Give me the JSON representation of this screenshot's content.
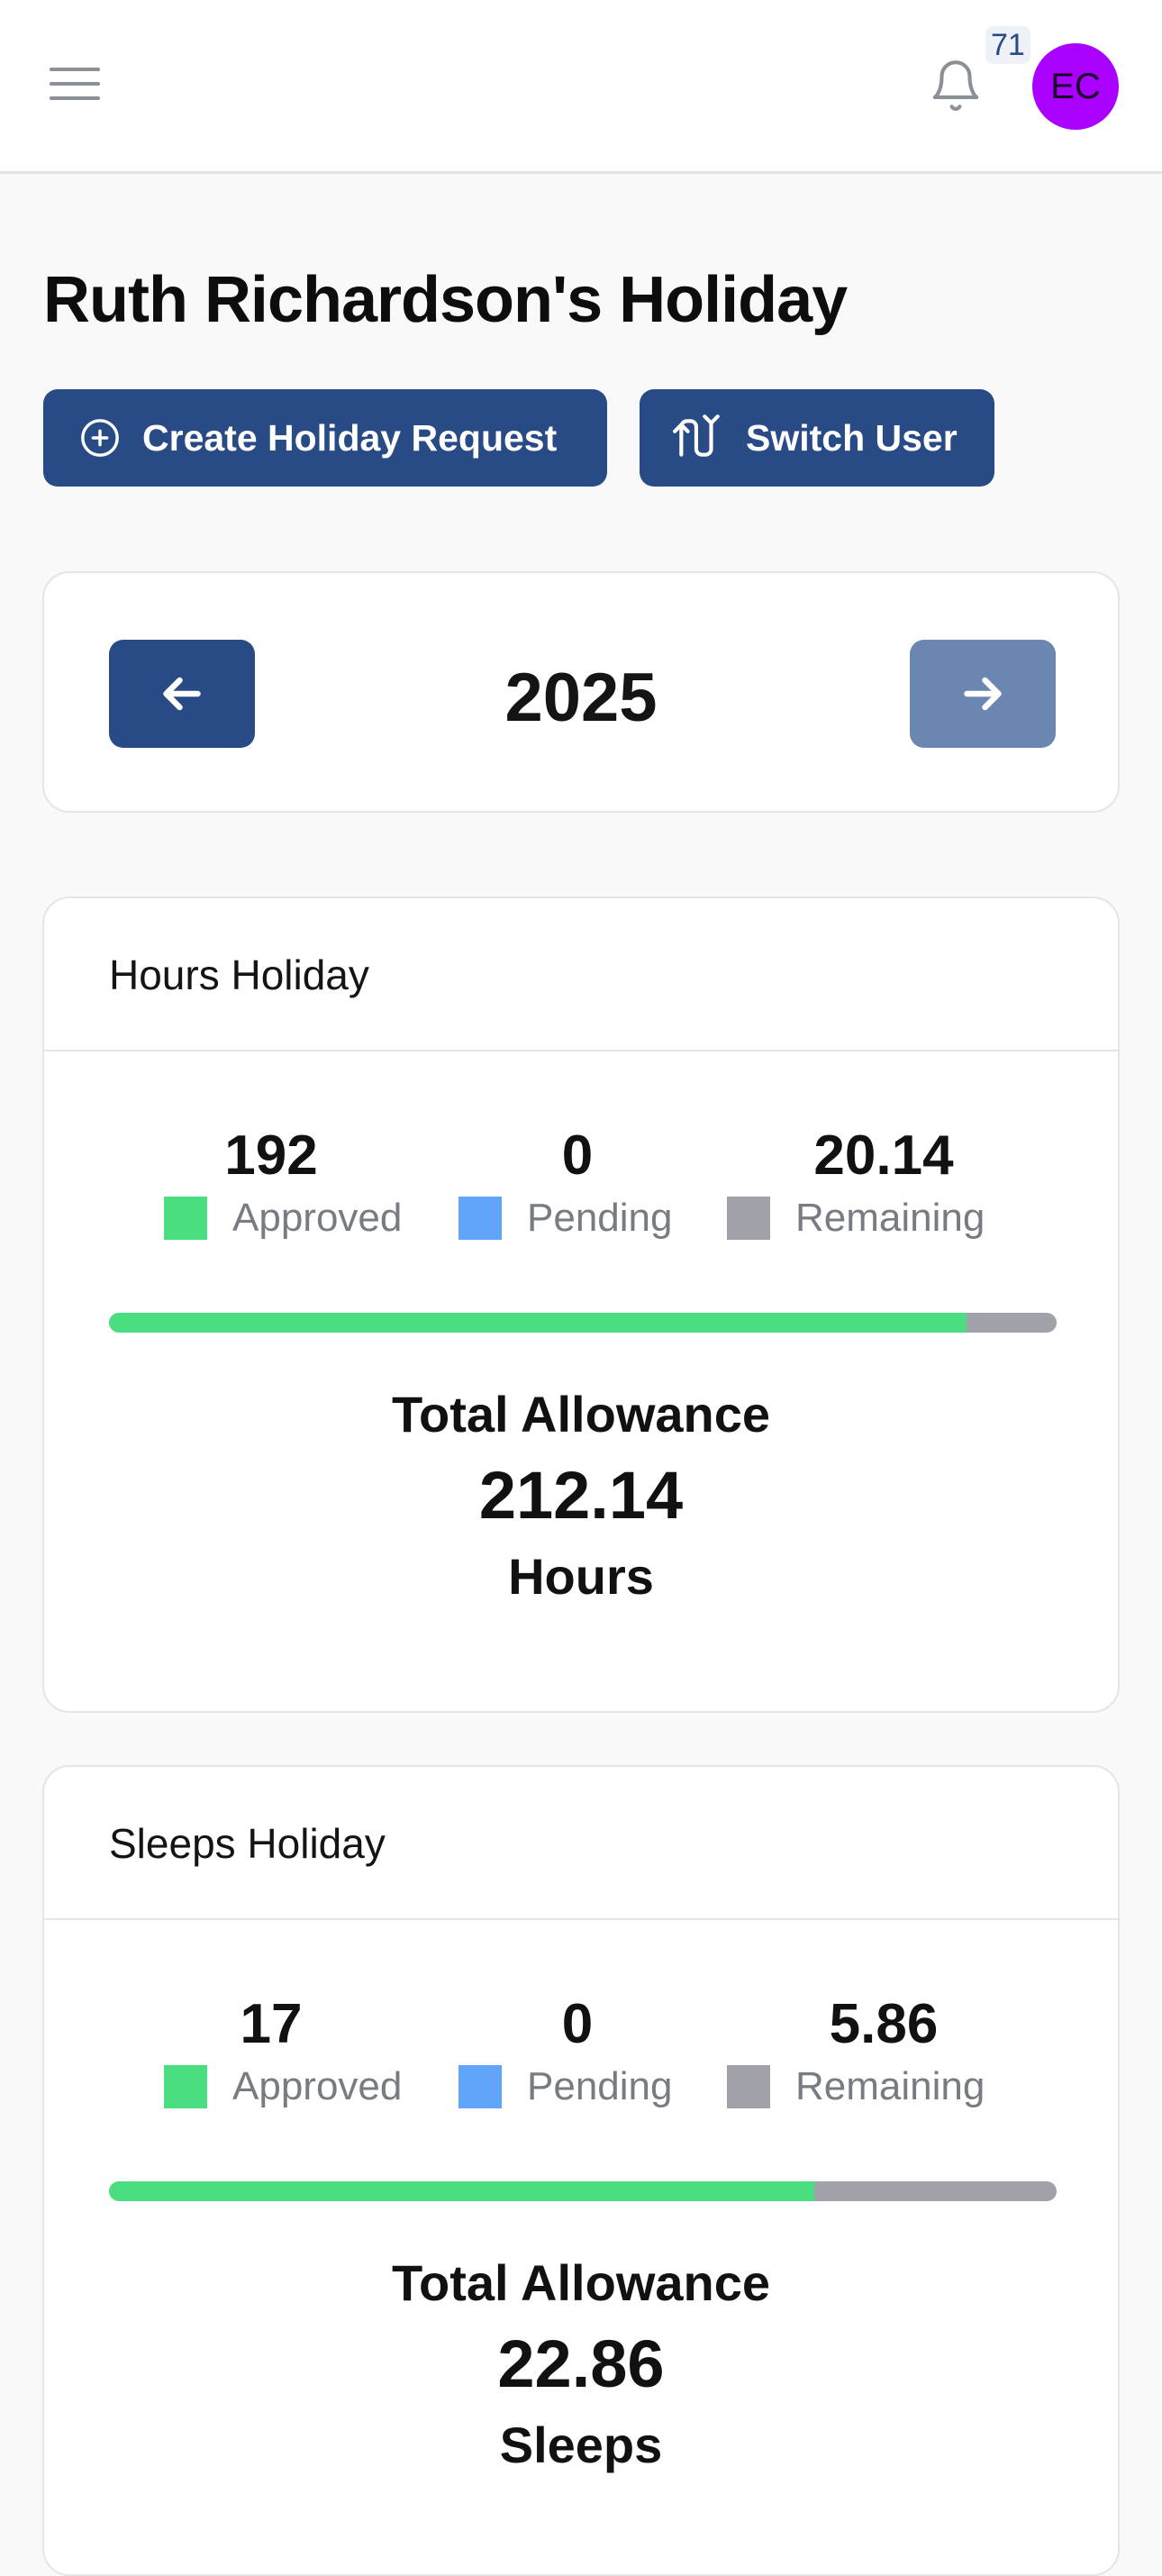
{
  "header": {
    "menu_icon": "hamburger-menu-icon",
    "bell_icon": "bell-icon",
    "notification_count": "71",
    "avatar_initials": "EC",
    "avatar_color": "#aa00ff"
  },
  "page": {
    "title": "Ruth Richardson's Holiday"
  },
  "actions": {
    "create_label": "Create Holiday Request",
    "create_icon": "plus-circle-icon",
    "switch_label": "Switch User",
    "switch_icon": "swap-arrows-icon"
  },
  "year_nav": {
    "year": "2025",
    "prev_icon": "arrow-left-icon",
    "next_icon": "arrow-right-icon"
  },
  "colors": {
    "primary": "#284b86",
    "approved": "#4ade80",
    "pending": "#60a5fa",
    "remaining": "#a1a2a9"
  },
  "hours": {
    "title": "Hours Holiday",
    "approved_value": "192",
    "pending_value": "0",
    "remaining_value": "20.14",
    "approved_label": "Approved",
    "pending_label": "Pending",
    "remaining_label": "Remaining",
    "approved_fraction": 0.905,
    "pending_fraction": 0,
    "total_label": "Total Allowance",
    "total_value": "212.14",
    "unit": "Hours"
  },
  "sleeps": {
    "title": "Sleeps Holiday",
    "approved_value": "17",
    "pending_value": "0",
    "remaining_value": "5.86",
    "approved_label": "Approved",
    "pending_label": "Pending",
    "remaining_label": "Remaining",
    "approved_fraction": 0.744,
    "pending_fraction": 0,
    "total_label": "Total Allowance",
    "total_value": "22.86",
    "unit": "Sleeps"
  }
}
